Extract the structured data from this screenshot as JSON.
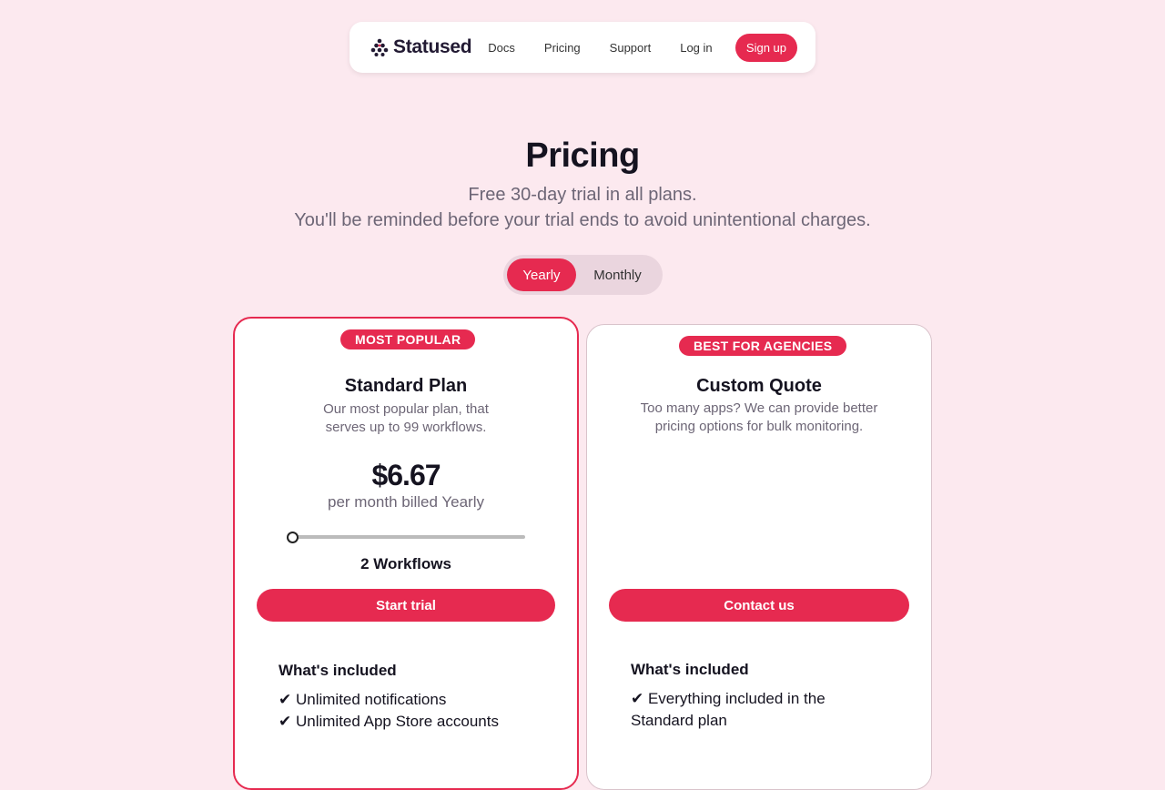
{
  "nav": {
    "brand": "Statused",
    "links": [
      "Docs",
      "Pricing",
      "Support",
      "Log in"
    ],
    "signup": "Sign up"
  },
  "hero": {
    "title": "Pricing",
    "subtitle_line1": "Free 30-day trial in all plans.",
    "subtitle_line2": "You'll be reminded before your trial ends to avoid unintentional charges."
  },
  "billing_toggle": {
    "options": [
      "Yearly",
      "Monthly"
    ],
    "selected": "Yearly"
  },
  "plans": [
    {
      "badge": "MOST POPULAR",
      "title": "Standard Plan",
      "description": "Our most popular plan, that serves up to 99 workflows.",
      "price": "$6.67",
      "price_note": "per month billed Yearly",
      "workflows_label": "2 Workflows",
      "slider_fraction": 0.0,
      "cta": "Start trial",
      "included_title": "What's included",
      "features": [
        "✔ Unlimited notifications",
        "✔ Unlimited App Store accounts"
      ]
    },
    {
      "badge": "BEST FOR AGENCIES",
      "title": "Custom Quote",
      "description": "Too many apps? We can provide better pricing options for bulk monitoring.",
      "cta": "Contact us",
      "included_title": "What's included",
      "features": [
        "✔ Everything included in the Standard plan"
      ]
    }
  ],
  "colors": {
    "accent": "#e62a50",
    "background": "#fce9ef"
  }
}
